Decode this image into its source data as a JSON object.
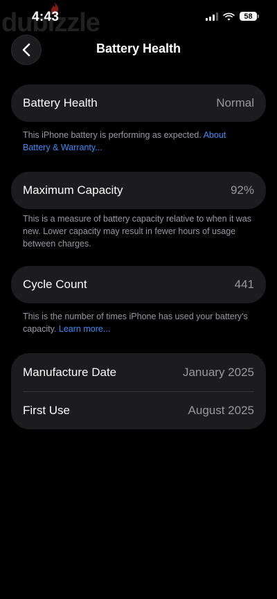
{
  "status_bar": {
    "time": "4:43",
    "battery_level": "58",
    "watermark": "dubizzle"
  },
  "nav": {
    "title": "Battery Health",
    "back_icon": "chevron-left-icon"
  },
  "battery_health": {
    "label": "Battery Health",
    "value": "Normal",
    "footnote": "This iPhone battery is performing as expected.",
    "link": "About Battery & Warranty..."
  },
  "maximum_capacity": {
    "label": "Maximum Capacity",
    "value": "92%",
    "footnote": "This is a measure of battery capacity relative to when it was new. Lower capacity may result in fewer hours of usage between charges."
  },
  "cycle_count": {
    "label": "Cycle Count",
    "value": "441",
    "footnote": "This is the number of times iPhone has used your battery's capacity.",
    "link": "Learn more..."
  },
  "dates": {
    "manufacture_label": "Manufacture Date",
    "manufacture_value": "January 2025",
    "first_use_label": "First Use",
    "first_use_value": "August 2025"
  },
  "colors": {
    "background": "#000000",
    "card": "#1c1c1e",
    "secondary_text": "#98989f",
    "link": "#3b8cf6"
  }
}
